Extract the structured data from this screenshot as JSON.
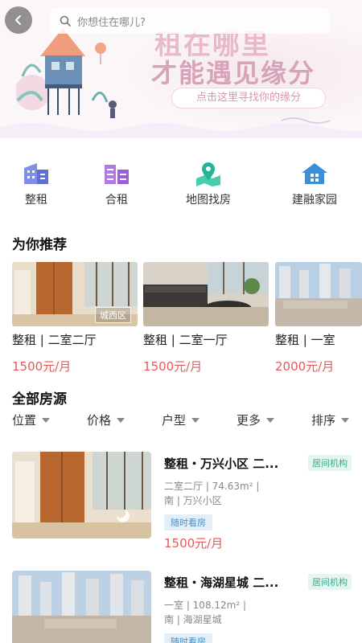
{
  "header": {
    "search_placeholder": "你想住在哪儿?"
  },
  "banner": {
    "title_line1": "租在哪里",
    "title_line2": "才能遇见缘分",
    "cta": "点击这里寻找你的缘分"
  },
  "categories": [
    {
      "label": "整租",
      "icon": "building-icon",
      "color": "#6f7fe0"
    },
    {
      "label": "合租",
      "icon": "shared-building-icon",
      "color": "#a566d9"
    },
    {
      "label": "地图找房",
      "icon": "map-pin-icon",
      "color": "#2ec2a2"
    },
    {
      "label": "建融家园",
      "icon": "home-icon",
      "color": "#3b8fd8"
    }
  ],
  "recommend": {
    "title": "为你推荐",
    "items": [
      {
        "name": "整租 | 二室二厅",
        "price": "1500元/月",
        "tag": "城西区"
      },
      {
        "name": "整租 | 二室一厅",
        "price": "1500元/月",
        "tag": ""
      },
      {
        "name": "整租 | 一室",
        "price": "2000元/月",
        "tag": ""
      }
    ]
  },
  "all": {
    "title": "全部房源",
    "filters": [
      "位置",
      "价格",
      "户型",
      "更多",
      "排序"
    ]
  },
  "listings": [
    {
      "title": "整租・万兴小区 二...",
      "badge": "居间机构",
      "desc1": "二室二厅 | 74.63m² |",
      "desc2": "南 | 万兴小区",
      "feature": "随时看房",
      "price": "1500元/月"
    },
    {
      "title": "整租・海湖星城 二...",
      "badge": "居间机构",
      "desc1": "一室 | 108.12m² |",
      "desc2": "南 | 海湖星城",
      "feature": "随时看房",
      "price": ""
    }
  ],
  "colors": {
    "accent_price": "#e45a5a",
    "badge_green": "#3ba98d",
    "feature_blue": "#4b8fc4"
  }
}
